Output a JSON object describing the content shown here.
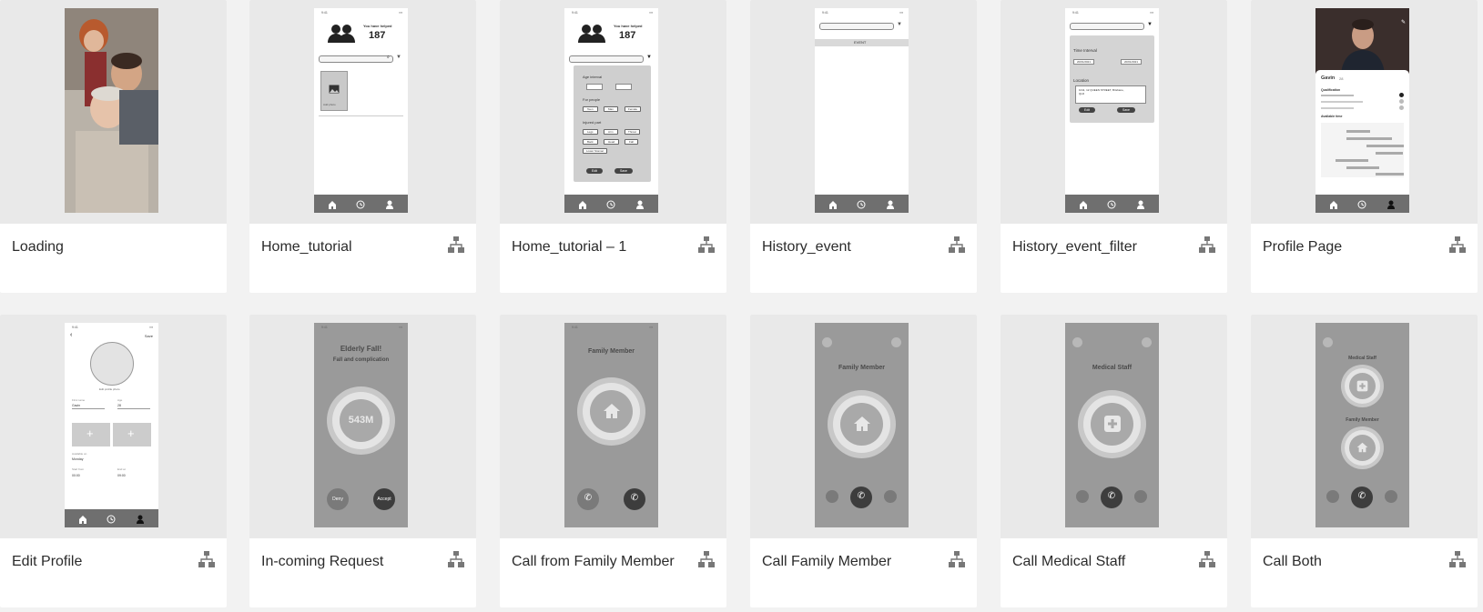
{
  "cards": [
    {
      "label": "Loading",
      "flow_icon": false
    },
    {
      "label": "Home_tutorial",
      "flow_icon": true
    },
    {
      "label": "Home_tutorial – 1",
      "flow_icon": true
    },
    {
      "label": "History_event",
      "flow_icon": true
    },
    {
      "label": "History_event_filter",
      "flow_icon": true
    },
    {
      "label": "Profile Page",
      "flow_icon": true
    },
    {
      "label": "Edit Profile",
      "flow_icon": true
    },
    {
      "label": "In-coming Request",
      "flow_icon": true
    },
    {
      "label": "Call from Family Member",
      "flow_icon": true
    },
    {
      "label": "Call Family Member",
      "flow_icon": true
    },
    {
      "label": "Call Medical Staff",
      "flow_icon": true
    },
    {
      "label": "Call Both",
      "flow_icon": true
    }
  ],
  "thumbs": {
    "helped_text": "You have helped",
    "helped_count": "187",
    "add_photo": "Add photo",
    "age_interval": "Age interval",
    "for_people": "For people",
    "people_opts": [
      "Teen",
      "Man",
      "Female"
    ],
    "injured_part": "Injured part",
    "injured_opts": [
      "Legs",
      "Arm",
      "Throat",
      "Back",
      "Head",
      "Fall",
      "Lower Stomac"
    ],
    "edit": "Edit",
    "save": "Save",
    "event": "EVENT",
    "time_interval": "Time Interval",
    "date_from": "20/01/2021",
    "date_to": "20/01/2021",
    "location": "Location",
    "location_value": "1011, 12 QUEEN STREET, Brisbane, QLD",
    "profile_name": "Gavin",
    "profile_age": "28",
    "qualification": "Qualification",
    "available_time": "Available time",
    "save_small": "Save",
    "edit_photo": "Edit profile photo",
    "first_name_label": "First name",
    "first_name": "Gavin",
    "age_label": "Age",
    "age": "28",
    "available_label": "Available on",
    "available_day": "Monday",
    "start_label": "Start from",
    "start_time": "00:00",
    "end_label": "End at",
    "end_time": "09:00",
    "elderly_fall": "Elderly Fall!",
    "fall_complication": "Fall and complication",
    "distance": "543M",
    "deny": "Deny",
    "accept": "Accept",
    "family_member": "Family Member",
    "medical_staff": "Medical Staff"
  },
  "colors": {
    "page_bg": "#f2f2f2",
    "card_bg": "#ffffff",
    "thumb_bg": "#e9e9e9",
    "navbar": "#6f6f6f",
    "call_bg": "#9a9a9a"
  }
}
